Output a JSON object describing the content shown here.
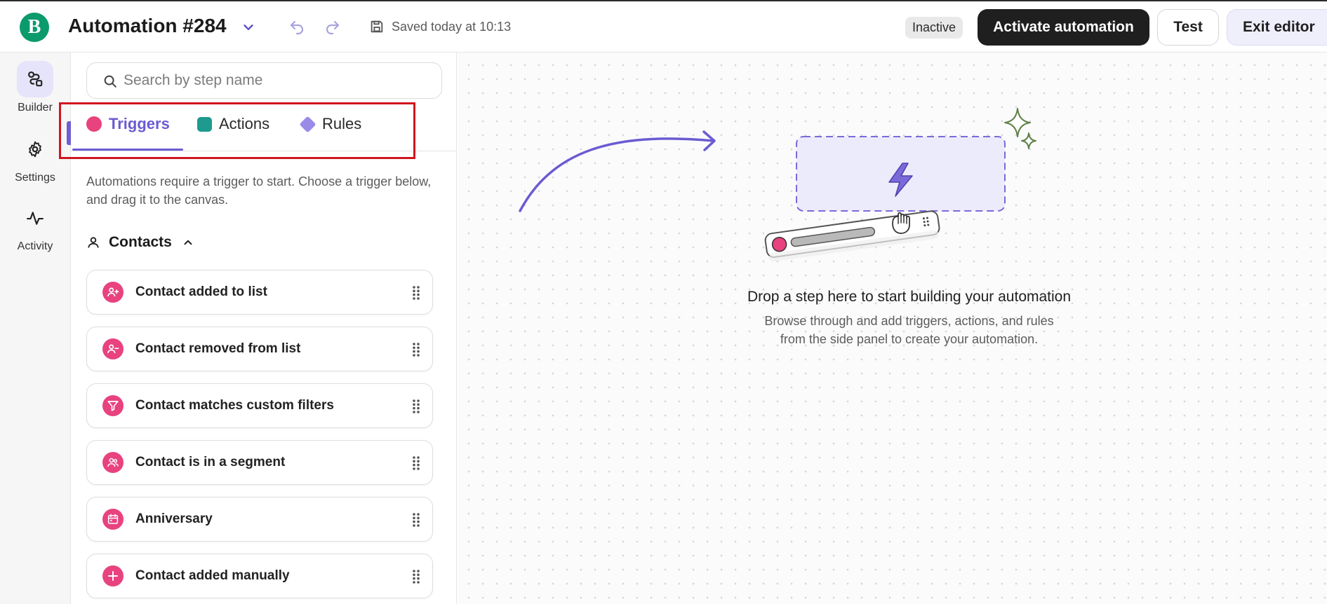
{
  "header": {
    "logo_letter": "B",
    "title": "Automation #284",
    "saved_text": "Saved today at 10:13",
    "status": "Inactive",
    "activate_label": "Activate automation",
    "test_label": "Test",
    "exit_label": "Exit editor"
  },
  "rail": {
    "items": [
      {
        "label": "Builder",
        "icon": "builder-icon",
        "active": true
      },
      {
        "label": "Settings",
        "icon": "gear-icon",
        "active": false
      },
      {
        "label": "Activity",
        "icon": "activity-icon",
        "active": false
      }
    ]
  },
  "panel": {
    "search_placeholder": "Search by step name",
    "tabs": [
      {
        "label": "Triggers",
        "color": "#e8427f",
        "active": true
      },
      {
        "label": "Actions",
        "color": "#1e9a8f",
        "active": false
      },
      {
        "label": "Rules",
        "color": "#9a8be8",
        "active": false
      }
    ],
    "intro": "Automations require a trigger to start. Choose a trigger below, and drag it to the canvas.",
    "section_title": "Contacts",
    "steps": [
      {
        "label": "Contact added to list",
        "icon": "user-plus-icon"
      },
      {
        "label": "Contact removed from list",
        "icon": "user-minus-icon"
      },
      {
        "label": "Contact matches custom filters",
        "icon": "filter-icon"
      },
      {
        "label": "Contact is in a segment",
        "icon": "users-icon"
      },
      {
        "label": "Anniversary",
        "icon": "calendar-icon"
      },
      {
        "label": "Contact added manually",
        "icon": "plus-icon"
      }
    ]
  },
  "canvas": {
    "drop_title": "Drop a step here to start building your automation",
    "drop_sub_line1": "Browse through and add triggers, actions, and rules",
    "drop_sub_line2": "from the side panel to create your automation."
  },
  "colors": {
    "accent": "#6a5bd2",
    "trigger": "#e8427f",
    "action": "#1e9a8f",
    "rule": "#9a8be8",
    "highlight": "#d1151e"
  }
}
